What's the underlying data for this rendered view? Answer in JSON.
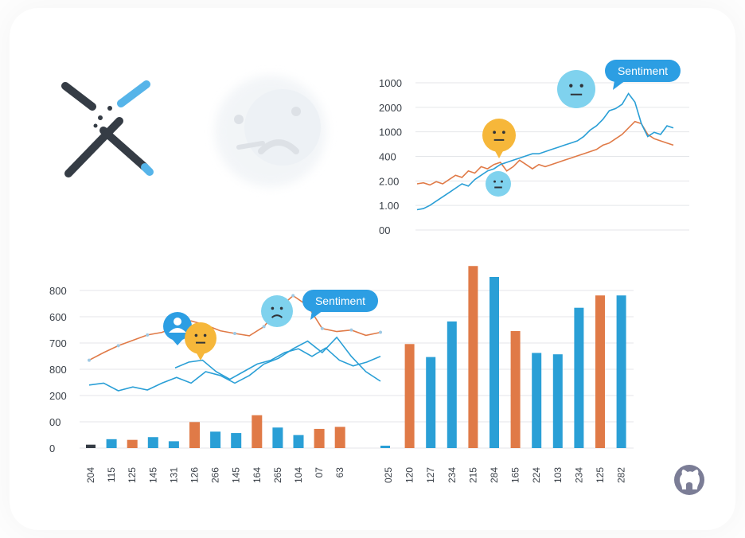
{
  "colors": {
    "blue": "#2a9fd6",
    "orange": "#e07a47",
    "gold": "#f6b73a",
    "light_blue": "#7fd2ee",
    "bubble": "#2c9ee3",
    "dark": "#353c45",
    "grid": "#e4e6e9"
  },
  "logo": {
    "icon": "x-logo-icon"
  },
  "faded_face": {
    "icon": "sad-face-icon"
  },
  "github": {
    "icon": "github-icon"
  },
  "chart_data": [
    {
      "type": "line",
      "title": "",
      "y_tick_labels": [
        "1000",
        "2000",
        "1000",
        "400",
        "2.00",
        "1.00",
        "00"
      ],
      "grid": true,
      "annotation": "Sentiment",
      "emoji": [
        "neutral-face",
        "neutral-face",
        "neutral-face"
      ],
      "series": [
        {
          "color": "orange",
          "y_level": [
            1.7,
            1.75,
            1.65,
            1.8,
            1.7,
            1.9,
            2.1,
            2.0,
            2.3,
            2.2,
            2.5,
            2.4,
            2.6,
            2.7,
            2.3,
            2.5,
            2.8,
            2.6,
            2.4,
            2.6,
            2.5,
            2.6,
            2.7,
            2.8,
            2.9,
            3.0,
            3.1,
            3.2,
            3.3,
            3.5,
            3.6,
            3.8,
            4.0,
            4.3,
            4.6,
            4.5,
            4.0,
            3.8,
            3.7,
            3.6,
            3.5
          ]
        },
        {
          "color": "blue",
          "y_level": [
            0.5,
            0.55,
            0.7,
            0.9,
            1.1,
            1.3,
            1.5,
            1.7,
            1.6,
            1.9,
            2.1,
            2.3,
            2.4,
            2.6,
            2.7,
            2.8,
            2.9,
            3.0,
            3.1,
            3.1,
            3.2,
            3.3,
            3.4,
            3.5,
            3.6,
            3.7,
            3.9,
            4.2,
            4.4,
            4.7,
            5.1,
            5.2,
            5.4,
            5.9,
            5.5,
            4.5,
            3.9,
            4.1,
            4.0,
            4.4,
            4.3
          ]
        }
      ]
    },
    {
      "type": "bar",
      "title": "",
      "y_tick_labels": [
        "800",
        "600",
        "700",
        "800",
        "200",
        "00",
        "0"
      ],
      "grid": true,
      "annotation": "Sentiment",
      "emoji": [
        "user-pin",
        "neutral-face",
        "sad-face"
      ],
      "categories": [
        "204",
        "115",
        "125",
        "145",
        "131",
        "126",
        "266",
        "145",
        "164",
        "265",
        "104",
        "07",
        "63",
        "025",
        "120",
        "127",
        "234",
        "215",
        "284",
        "165",
        "224",
        "103",
        "234",
        "125",
        "282"
      ],
      "bar_level": [
        5,
        13,
        12,
        16,
        10,
        38,
        24,
        22,
        48,
        30,
        19,
        28,
        31,
        16,
        3,
        152,
        133,
        185,
        266,
        250,
        171,
        139,
        137,
        205,
        223
      ],
      "bar_colors": [
        "dark",
        "blue",
        "orange",
        "blue",
        "blue",
        "orange",
        "blue",
        "blue",
        "orange",
        "blue",
        "blue",
        "orange",
        "orange",
        "blue",
        "blue",
        "orange",
        "blue",
        "blue",
        "orange",
        "blue",
        "orange",
        "blue",
        "blue",
        "blue",
        "orange",
        "blue"
      ],
      "overlay_series": [
        {
          "color": "orange",
          "y_level": [
            230,
            250,
            268,
            282,
            296,
            303,
            318,
            333,
            322,
            307,
            300,
            294,
            318,
            365,
            399,
            373,
            313,
            305,
            309,
            295,
            303
          ]
        },
        {
          "color": "blue",
          "y_level": [
            165,
            170,
            150,
            160,
            152,
            170,
            185,
            170,
            200,
            190,
            170,
            190,
            220,
            235,
            260,
            280,
            250,
            290,
            240,
            200,
            175
          ]
        },
        {
          "color": "blue",
          "y_level": [
            210,
            225,
            230,
            200,
            180,
            200,
            220,
            230,
            250,
            260,
            240,
            262,
            230,
            215,
            225,
            240
          ]
        }
      ]
    }
  ]
}
